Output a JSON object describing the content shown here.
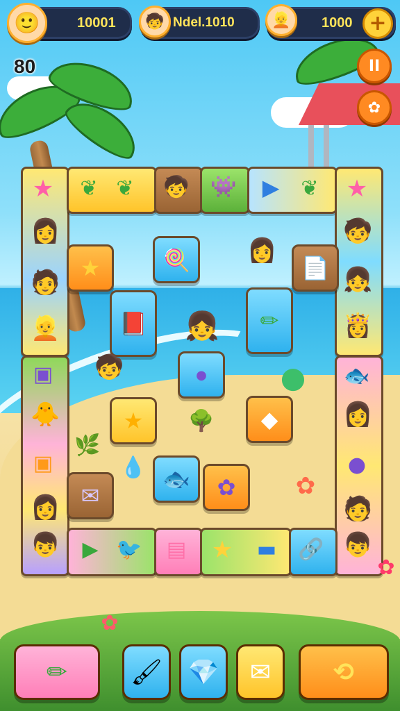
{
  "hud": {
    "player_avatar": "player-avatar-icon",
    "score_value": "10001",
    "level_value": "Ndel.1010",
    "coins_value": "1000",
    "moves_left": "80",
    "plus_symbol": "+",
    "pause_symbol": "II",
    "hint_symbol": "✿"
  },
  "board": {
    "tiles": [
      {
        "name": "star-tile",
        "icon": "★",
        "color": "#ff5fa8"
      },
      {
        "name": "leaf-tile",
        "icon": "🍃",
        "color": "#3aa83c"
      },
      {
        "name": "character-tile",
        "icon": "🧒",
        "color": "#8a5a2e"
      },
      {
        "name": "blob-tile",
        "icon": "👾",
        "color": "#e84a6a"
      },
      {
        "name": "play-tile",
        "icon": "▶",
        "color": "#2f7fe0"
      },
      {
        "name": "star-tile",
        "icon": "★",
        "color": "#ff8a1a"
      },
      {
        "name": "lollipop-tile",
        "icon": "🍭",
        "color": "#ff5fa8"
      },
      {
        "name": "paper-tile",
        "icon": "📄",
        "color": "#5a7ad0"
      },
      {
        "name": "book-tile",
        "icon": "📕",
        "color": "#ff6fa8"
      },
      {
        "name": "pencil-tile",
        "icon": "✏",
        "color": "#3aa83c"
      },
      {
        "name": "cube-tile",
        "icon": "▣",
        "color": "#2fb2ee"
      },
      {
        "name": "slime-tile",
        "icon": "●",
        "color": "#3dbf6a"
      },
      {
        "name": "star-tile",
        "icon": "★",
        "color": "#ffd23a"
      },
      {
        "name": "tree-tile",
        "icon": "🌳",
        "color": "#3aa83c"
      },
      {
        "name": "crystal-tile",
        "icon": "◆",
        "color": "#e9e9ff"
      },
      {
        "name": "drop-tile",
        "icon": "💧",
        "color": "#2fb2ee"
      },
      {
        "name": "fish-tile",
        "icon": "🐟",
        "color": "#27a2d8"
      },
      {
        "name": "flower-tile",
        "icon": "✿",
        "color": "#7a4fd0"
      },
      {
        "name": "envelope-tile",
        "icon": "✉",
        "color": "#a08cd8"
      },
      {
        "name": "triangle-tile",
        "icon": "▶",
        "color": "#3aa83c"
      },
      {
        "name": "bird-tile",
        "icon": "🐦",
        "color": "#3aa83c"
      },
      {
        "name": "note-tile",
        "icon": "▤",
        "color": "#ff6fa8"
      },
      {
        "name": "star-tile",
        "icon": "★",
        "color": "#ffd23a"
      },
      {
        "name": "tube-tile",
        "icon": "▬",
        "color": "#2f7fe0"
      },
      {
        "name": "link-tile",
        "icon": "🔗",
        "color": "#ff6fa8"
      }
    ]
  },
  "toolbar": {
    "buttons": [
      {
        "name": "pencil-button",
        "icon": "✏"
      },
      {
        "name": "brush-button",
        "icon": "🖌"
      },
      {
        "name": "gem-button",
        "icon": "💎"
      },
      {
        "name": "envelope-button",
        "icon": "✉"
      },
      {
        "name": "swap-button",
        "icon": "⟲"
      }
    ]
  },
  "colors": {
    "hud_pill": "#1f2d4a",
    "score_text": "#ffe45a",
    "accent_orange": "#ff8a22",
    "button_pink": "#ff7fb8",
    "button_blue": "#2fb2ee",
    "button_yellow": "#ffc42a"
  }
}
